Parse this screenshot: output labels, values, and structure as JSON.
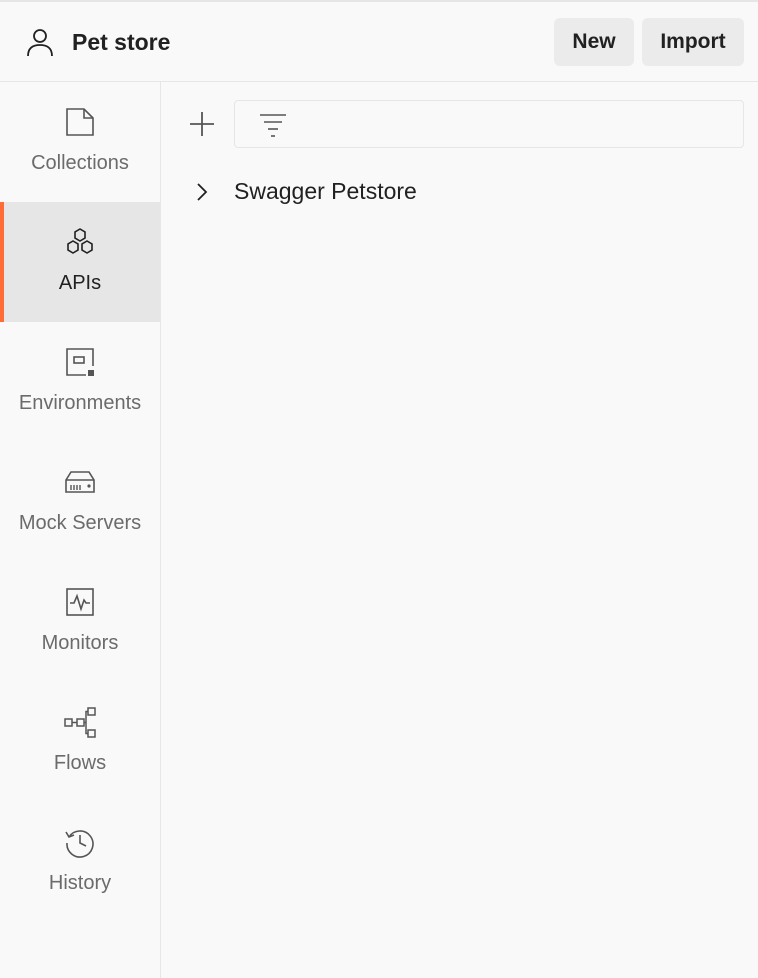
{
  "header": {
    "workspace_name": "Pet store",
    "new_label": "New",
    "import_label": "Import"
  },
  "sidebar": {
    "items": [
      {
        "label": "Collections",
        "icon": "collections-icon",
        "active": false
      },
      {
        "label": "APIs",
        "icon": "apis-icon",
        "active": true
      },
      {
        "label": "Environments",
        "icon": "environments-icon",
        "active": false
      },
      {
        "label": "Mock Servers",
        "icon": "mock-servers-icon",
        "active": false
      },
      {
        "label": "Monitors",
        "icon": "monitors-icon",
        "active": false
      },
      {
        "label": "Flows",
        "icon": "flows-icon",
        "active": false
      },
      {
        "label": "History",
        "icon": "history-icon",
        "active": false
      }
    ]
  },
  "main": {
    "filter_placeholder": "",
    "apis": [
      {
        "name": "Swagger Petstore"
      }
    ]
  },
  "colors": {
    "accent": "#ff6c37",
    "active_bg": "#e6e6e6",
    "button_bg": "#ebebeb"
  }
}
